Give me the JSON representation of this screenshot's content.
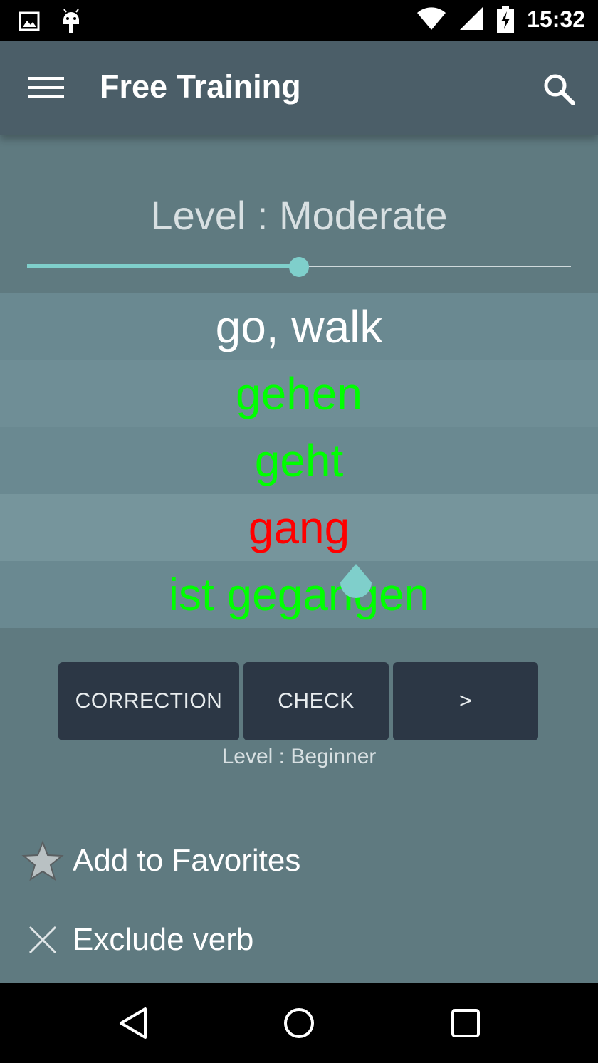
{
  "status_bar": {
    "time": "15:32",
    "icons": [
      "image-icon",
      "android-icon",
      "wifi-icon",
      "signal-icon",
      "battery-charging-icon"
    ]
  },
  "app_bar": {
    "title": "Free Training",
    "menu_icon": "hamburger-menu-icon",
    "search_icon": "search-icon"
  },
  "level": {
    "title": "Level : Moderate",
    "slider_fraction": 0.5
  },
  "verb": {
    "translation": "go, walk",
    "forms": [
      {
        "text": "gehen",
        "color": "#00ff00"
      },
      {
        "text": "geht",
        "color": "#00ff00"
      },
      {
        "text": "gang",
        "color": "#ff0000"
      },
      {
        "text": "ist gegangen",
        "color": "#00ff00"
      }
    ]
  },
  "buttons": {
    "correction": "CORRECTION",
    "check": "CHECK",
    "next": ">"
  },
  "sub_level": "Level : Beginner",
  "actions": {
    "favorites": "Add to Favorites",
    "exclude": "Exclude verb"
  },
  "colors": {
    "accent": "#7fcfcb",
    "button_bg": "#2c3745",
    "app_bar": "#4b5e68",
    "background": "#5f7a80"
  }
}
